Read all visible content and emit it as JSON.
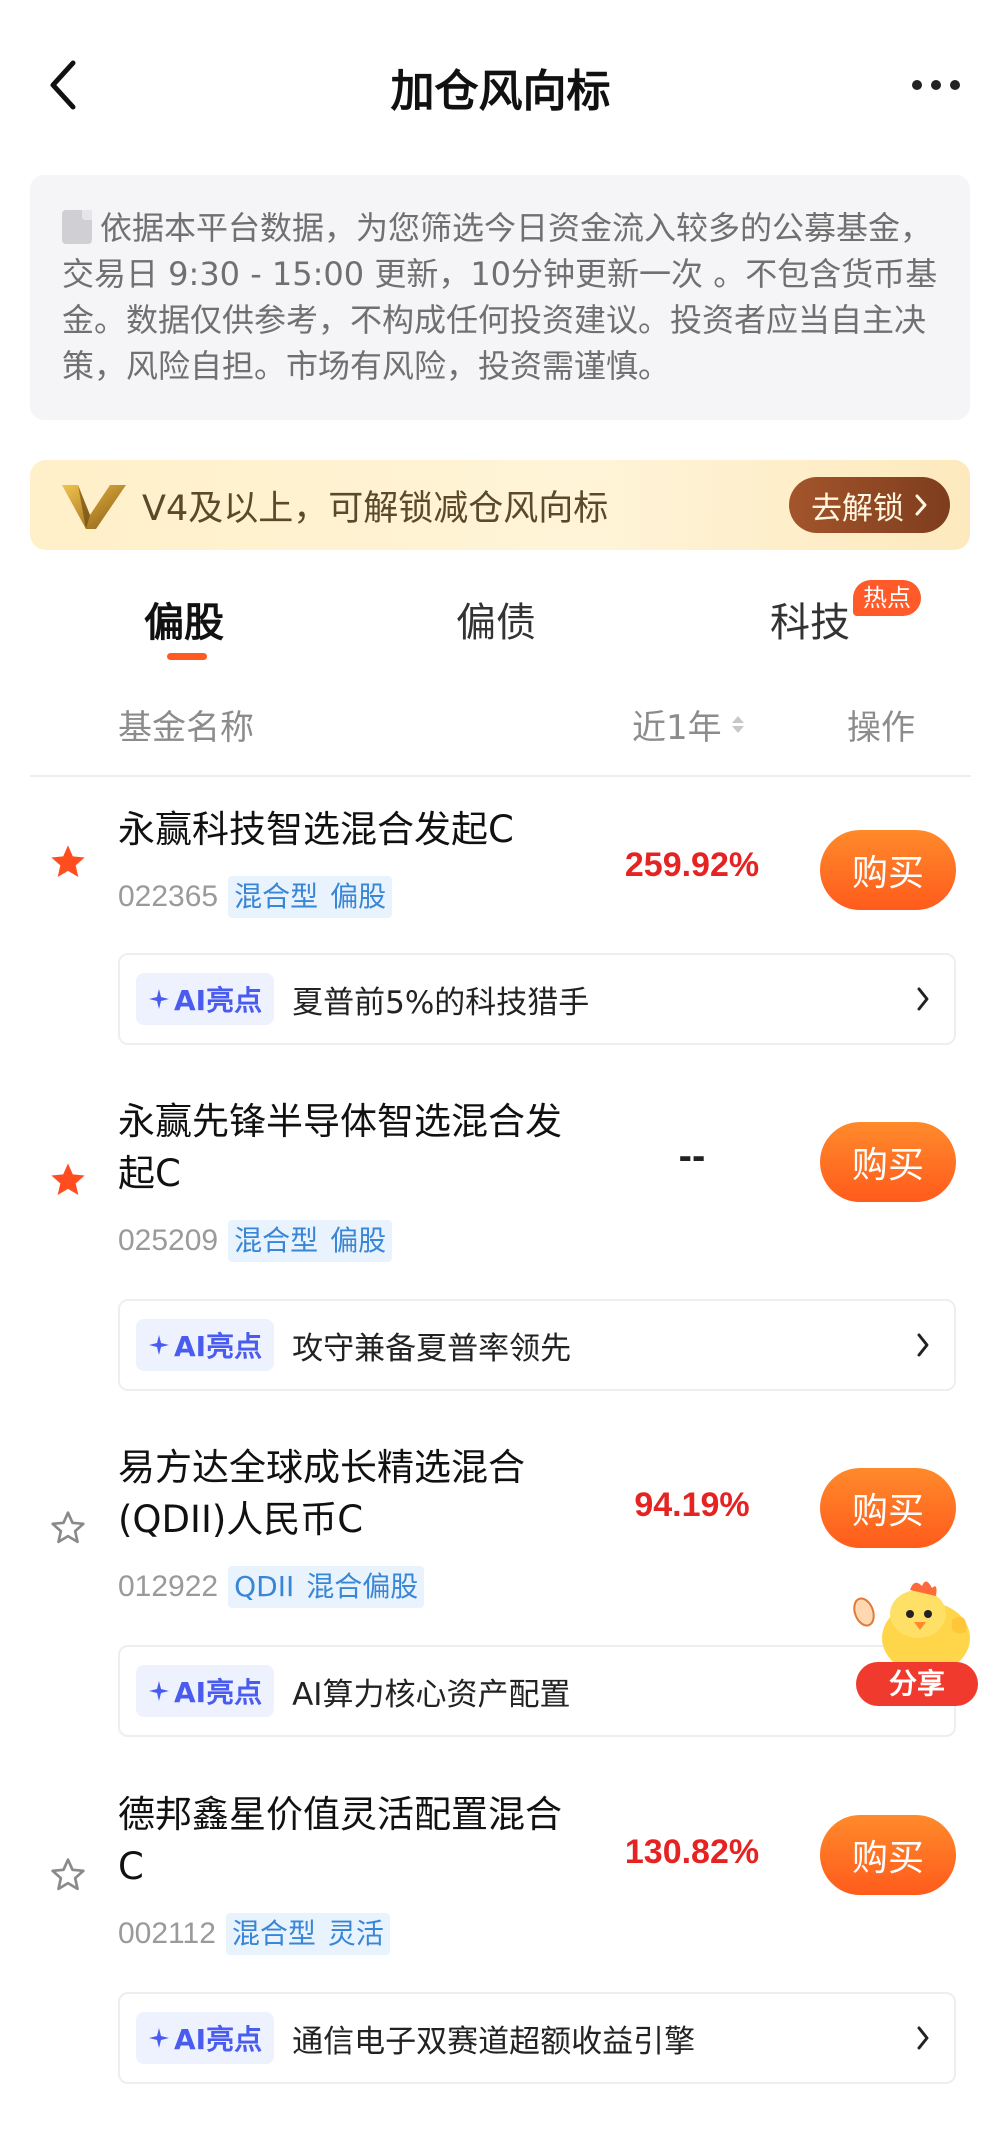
{
  "nav": {
    "title": "加仓风向标"
  },
  "notice": {
    "text": "依据本平台数据，为您筛选今日资金流入较多的公募基金，交易日 9:30 - 15:00 更新，10分钟更新一次 。不包含货币基金。数据仅供参考，不构成任何投资建议。投资者应当自主决策，风险自担。市场有风险，投资需谨慎。"
  },
  "banner": {
    "text": "V4及以上，可解锁减仓风向标",
    "button": "去解锁"
  },
  "tabs": {
    "items": [
      {
        "label": "偏股"
      },
      {
        "label": "偏债"
      },
      {
        "label": "科技"
      }
    ],
    "active": "偏股",
    "hot_badge": "热点"
  },
  "table": {
    "headers": {
      "name": "基金名称",
      "period": "近1年",
      "action": "操作"
    }
  },
  "funds": [
    {
      "name": "永赢科技智选混合发起C",
      "code": "022365",
      "tags": [
        "混合型",
        "偏股"
      ],
      "return": "259.92%",
      "favorited": true,
      "buy": "购买",
      "ai_label": "AI亮点",
      "ai_text": "夏普前5%的科技猎手"
    },
    {
      "name": "永赢先锋半导体智选混合发起C",
      "code": "025209",
      "tags": [
        "混合型",
        "偏股"
      ],
      "return": "--",
      "favorited": true,
      "buy": "购买",
      "ai_label": "AI亮点",
      "ai_text": "攻守兼备夏普率领先"
    },
    {
      "name": "易方达全球成长精选混合(QDII)人民币C",
      "code": "012922",
      "tags": [
        "QDII",
        "混合偏股"
      ],
      "return": "94.19%",
      "favorited": false,
      "buy": "购买",
      "ai_label": "AI亮点",
      "ai_text": "AI算力核心资产配置"
    },
    {
      "name": "德邦鑫星价值灵活配置混合C",
      "code": "002112",
      "tags": [
        "混合型",
        "灵活"
      ],
      "return": "130.82%",
      "favorited": false,
      "buy": "购买",
      "ai_label": "AI亮点",
      "ai_text": "通信电子双赛道超额收益引擎"
    }
  ],
  "share": {
    "label": "分享"
  },
  "colors": {
    "accent": "#ff5b1c",
    "return_red": "#e52323",
    "tag_blue": "#3a86d6",
    "star_filled": "#ff4d1f",
    "star_empty": "#8a8a8a"
  }
}
